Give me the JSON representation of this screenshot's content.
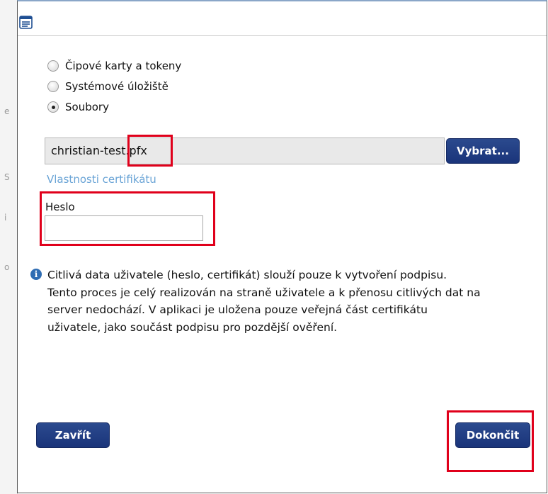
{
  "dialog": {
    "source_options": [
      {
        "label": "Čipové karty a tokeny",
        "selected": false
      },
      {
        "label": "Systémové úložiště",
        "selected": false
      },
      {
        "label": "Soubory",
        "selected": true
      }
    ],
    "file": {
      "value": "christian-test.pfx",
      "browse_label": "Vybrat..."
    },
    "certificate_properties_link": "Vlastnosti certifikátu",
    "password": {
      "label": "Heslo",
      "value": ""
    },
    "info_text": "Citlivá data uživatele (heslo, certifikát) slouží pouze k vytvoření podpisu.\nTento proces je celý realizován na straně uživatele a k přenosu citlivých dat na\nserver nedochází. V aplikaci je uložena pouze veřejná část certifikátu\nuživatele, jako součást podpisu pro pozdější ověření.",
    "close_label": "Zavřít",
    "finish_label": "Dokončit"
  },
  "colors": {
    "button": "#1f3c84",
    "link": "#6aa4d6",
    "highlight": "#e0001b",
    "info_icon": "#2f6db3"
  }
}
